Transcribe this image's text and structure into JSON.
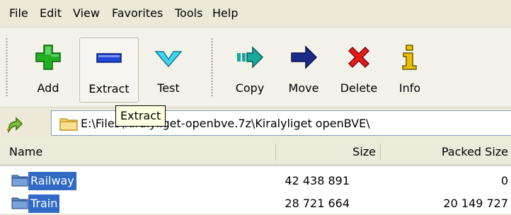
{
  "menu": [
    "File",
    "Edit",
    "View",
    "Favorites",
    "Tools",
    "Help"
  ],
  "toolbar": [
    {
      "label": "Add",
      "icon": "plus-icon",
      "color": "#1aa61a"
    },
    {
      "label": "Extract",
      "icon": "minus-icon",
      "color": "#1f3fcf"
    },
    {
      "label": "Test",
      "icon": "checkmark-icon",
      "color": "#2ec6e8"
    },
    {
      "label": "Copy",
      "icon": "copy-arrow-icon",
      "color": "#0f9a8f"
    },
    {
      "label": "Move",
      "icon": "move-arrow-icon",
      "color": "#1c2a8a"
    },
    {
      "label": "Delete",
      "icon": "delete-x-icon",
      "color": "#e01b1b"
    },
    {
      "label": "Info",
      "icon": "info-icon",
      "color": "#c9a300"
    }
  ],
  "tooltip": "Extract",
  "address": {
    "path": "E:\\Files\\Kiralyliget-openbve.7z\\Kiralyliget openBVE\\"
  },
  "columns": {
    "name": "Name",
    "size": "Size",
    "packed": "Packed Size"
  },
  "rows": [
    {
      "name": "Railway",
      "size": "42 438 891",
      "packed": "0"
    },
    {
      "name": "Train",
      "size": "28 721 664",
      "packed": "20 149 727"
    }
  ],
  "colors": {
    "selection": "#316ac5",
    "window": "#ece9d8",
    "tooltip": "#ffffe1"
  }
}
